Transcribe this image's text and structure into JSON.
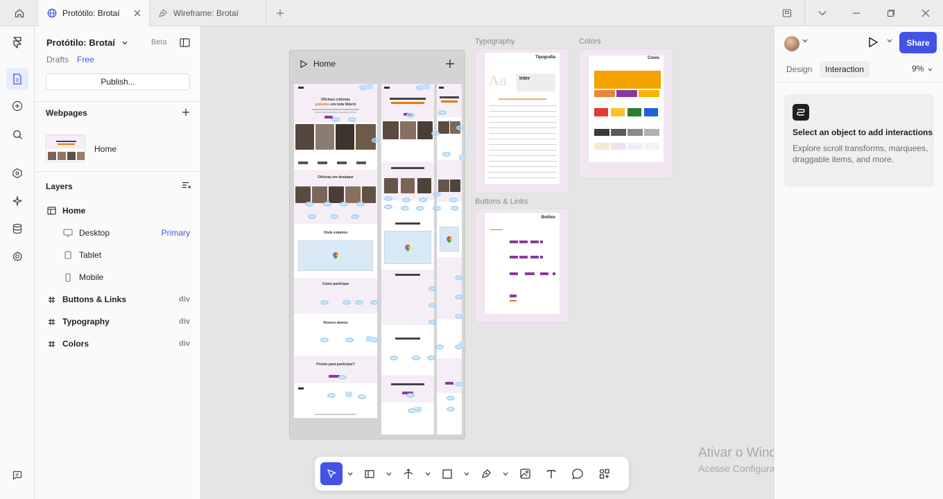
{
  "titlebar": {
    "tabs": [
      {
        "label": "Protótilo: Brotaí",
        "active": true
      },
      {
        "label": "Wireframe: Brotaí",
        "active": false
      }
    ]
  },
  "left_panel": {
    "project_title": "Protótilo: Brotaí",
    "beta_label": "Beta",
    "drafts_label": "Drafts",
    "plan_label": "Free",
    "publish_label": "Publish...",
    "webpages_title": "Webpages",
    "webpage_name": "Home",
    "layers_title": "Layers",
    "layers": [
      {
        "label": "Home",
        "right": ""
      },
      {
        "label": "Desktop",
        "right": "Primary"
      },
      {
        "label": "Tablet",
        "right": ""
      },
      {
        "label": "Mobile",
        "right": ""
      },
      {
        "label": "Buttons & Links",
        "right": "div"
      },
      {
        "label": "Typography",
        "right": "div"
      },
      {
        "label": "Colors",
        "right": "div"
      }
    ]
  },
  "canvas": {
    "home_frame_title": "Home",
    "frames": {
      "typography": "Typography",
      "colors": "Colors",
      "buttons": "Buttons & Links"
    },
    "typography_page_title": "Tipografia",
    "colors_page_title": "Cores",
    "buttons_page_title": "Botões",
    "mini": {
      "hero_line1": "Oficinas culturais",
      "hero_line2_accent": "gratuitas",
      "hero_line2_rest": "em toda Niterói",
      "workshops": "Oficinas em destaque",
      "where": "Onde estamos",
      "participate": "Como participar",
      "students": "Nossos alunos",
      "ready": "Pronto para participar?"
    },
    "colors": {
      "brand_orange": "#F5A300",
      "brand_purple": "#8A3A9D",
      "selection_blue": "#4353E6"
    }
  },
  "toolbar": {
    "tools": [
      "pointer-tool",
      "frame-tool",
      "transform-tool",
      "rectangle-tool",
      "pen-tool",
      "image-tool",
      "text-tool",
      "comment-tool",
      "plugins-tool"
    ]
  },
  "watermark": {
    "line1": "Ativar o Windows",
    "line2": "Acesse Configurações para ativar o Windows."
  },
  "help_label": "?",
  "right_panel": {
    "share_label": "Share",
    "tab_design": "Design",
    "tab_interaction": "Interaction",
    "zoom_label": "9%",
    "info_title": "Select an object to add interactions",
    "info_desc": "Explore scroll transforms, marquees, draggable items, and more."
  }
}
